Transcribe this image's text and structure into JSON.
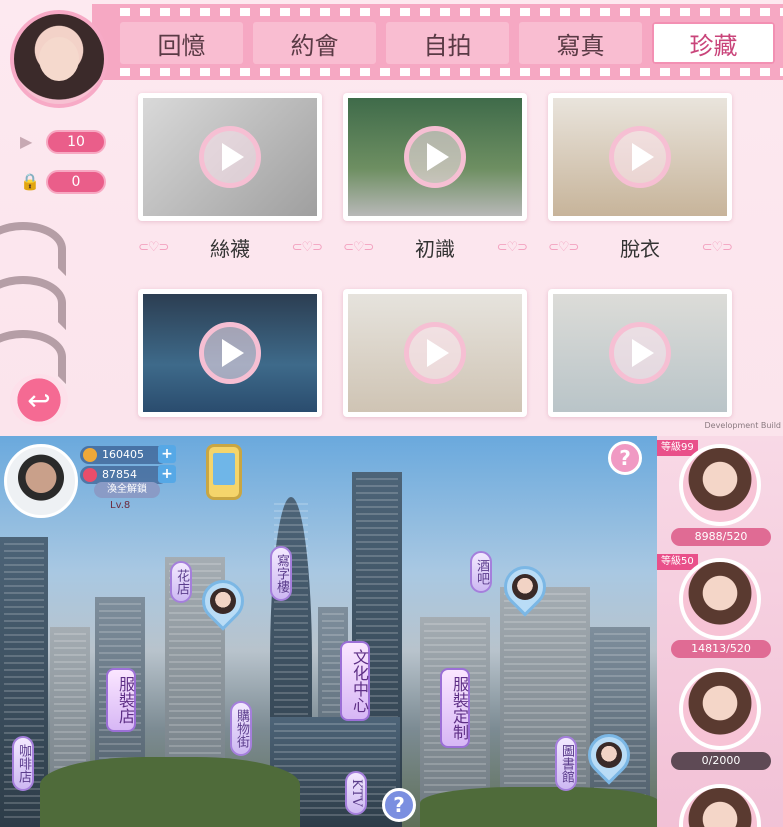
{
  "top": {
    "tabs": [
      {
        "label": "回憶",
        "active": false
      },
      {
        "label": "約會",
        "active": false
      },
      {
        "label": "自拍",
        "active": false
      },
      {
        "label": "寫真",
        "active": false
      },
      {
        "label": "珍藏",
        "active": true
      }
    ],
    "counters": {
      "plays": "10",
      "locked": "0"
    },
    "videos": [
      {
        "label": "絲襪"
      },
      {
        "label": "初識"
      },
      {
        "label": "脫衣"
      },
      {
        "label": ""
      },
      {
        "label": ""
      },
      {
        "label": ""
      }
    ],
    "dev_text": "Development Build"
  },
  "bottom": {
    "player": {
      "coins": "160405",
      "gems": "87854",
      "unlock_label": "渙全解鎖",
      "level": "Lv.8"
    },
    "locations": {
      "flower": "花店",
      "office": "寫字樓",
      "bar": "酒吧",
      "culture": "文化中心",
      "clothing": "服裝店",
      "shopping": "購物街",
      "tailor": "服裝定制",
      "library": "圖書館",
      "cafe": "咖啡店",
      "ktv": "KTV"
    },
    "help_glyph": "?",
    "characters": [
      {
        "level": "等級99",
        "affection": "8988/520"
      },
      {
        "level": "等級50",
        "affection": "14813/520"
      },
      {
        "level": "",
        "affection": "0/2000"
      }
    ]
  },
  "colors": {
    "accent_pink": "#ea5e8a",
    "film_pink": "#f6a8c3",
    "tag_red": "#e9508a"
  }
}
